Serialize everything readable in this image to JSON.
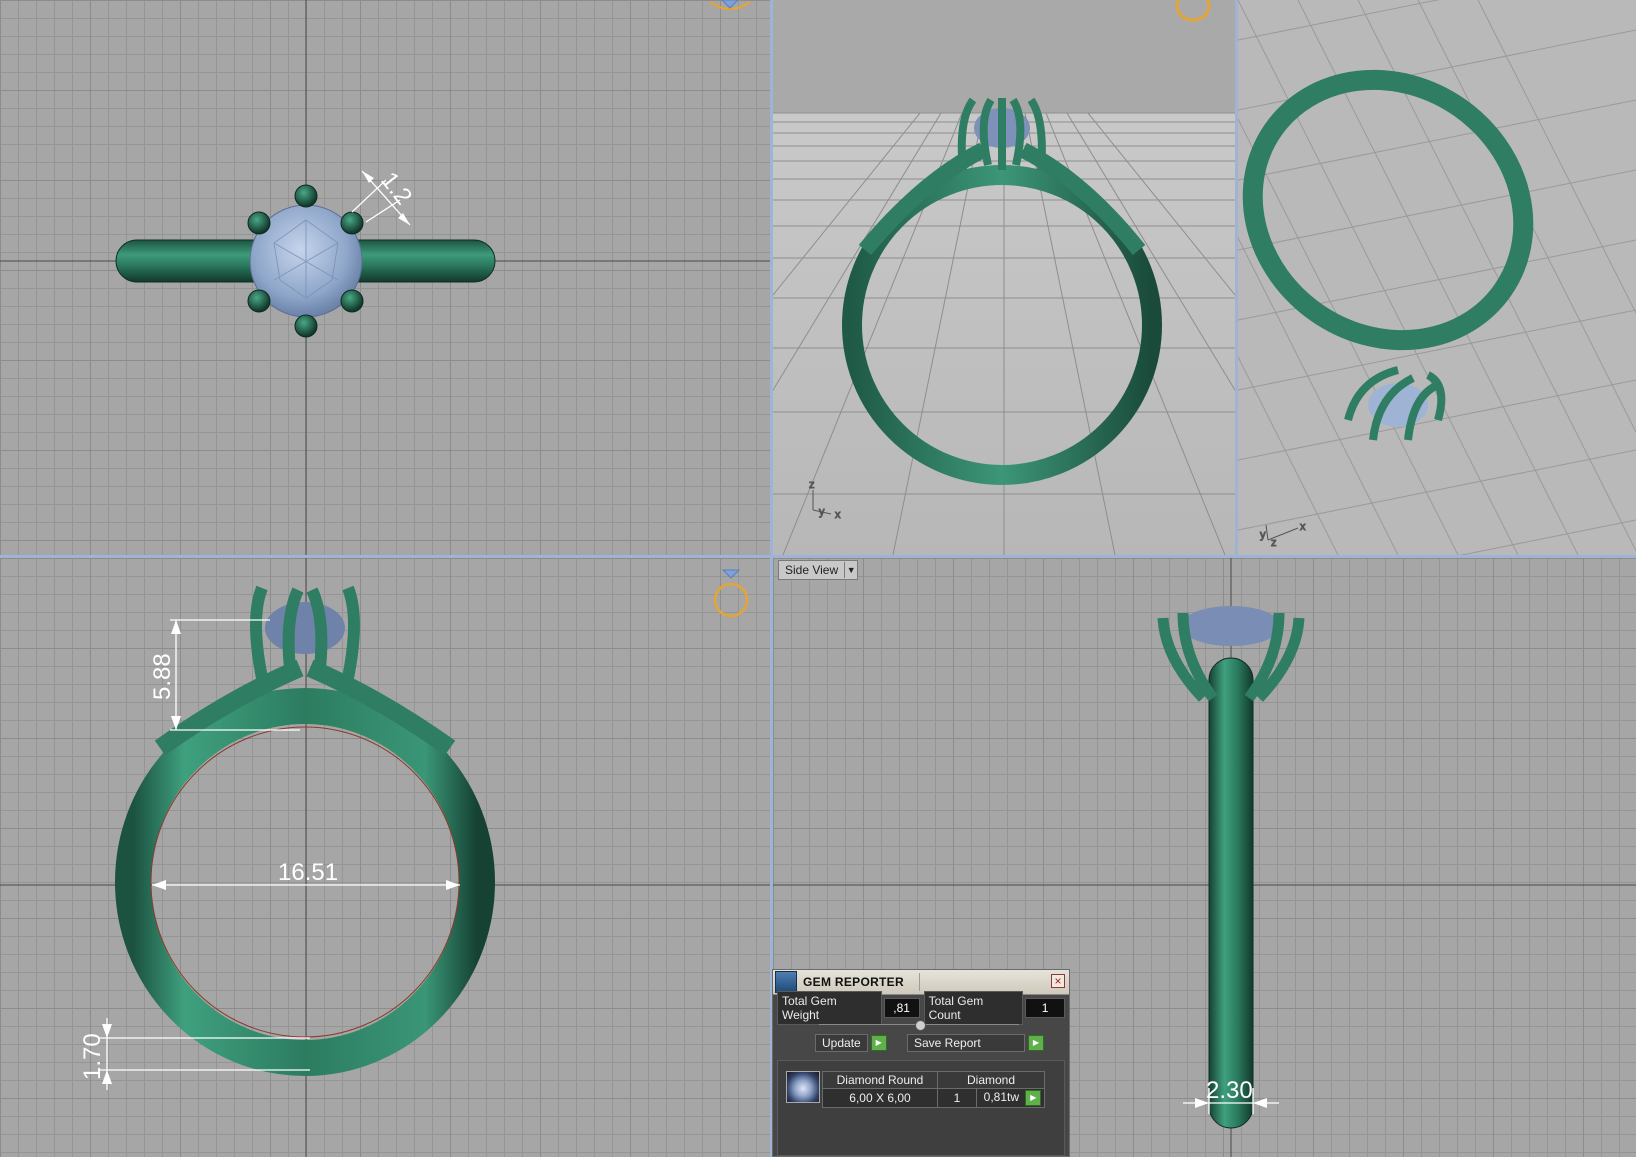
{
  "viewports": {
    "top_view": {
      "dimension": "1.2"
    },
    "front_view": {
      "dimensions": {
        "height": "5.88",
        "inner_diameter": "16.51",
        "band_thickness": "1.70"
      }
    },
    "side_view": {
      "label": "Side View",
      "dimension": "2.30"
    },
    "axis": {
      "x": "x",
      "y": "y",
      "z": "z"
    }
  },
  "gem_reporter": {
    "title": "GEM REPORTER",
    "total_weight_label": "Total Gem Weight",
    "total_weight_value": ",81",
    "total_count_label": "Total Gem Count",
    "total_count_value": "1",
    "update_label": "Update",
    "save_report_label": "Save Report",
    "row": {
      "cut": "Diamond Round",
      "material": "Diamond",
      "size": "6,00 X 6,00",
      "count": "1",
      "weight": "0,81tw"
    }
  },
  "colors": {
    "ring": "#2f7d62",
    "gem": "#9fb4d4",
    "viewport_bg": "#a6a6a6",
    "divider": "#9fb3d4",
    "accent": "#e3a538"
  },
  "icons": {
    "gem_thumbnail": "round-diamond-icon",
    "update": "play-icon",
    "save": "play-icon",
    "close": "close-icon"
  }
}
